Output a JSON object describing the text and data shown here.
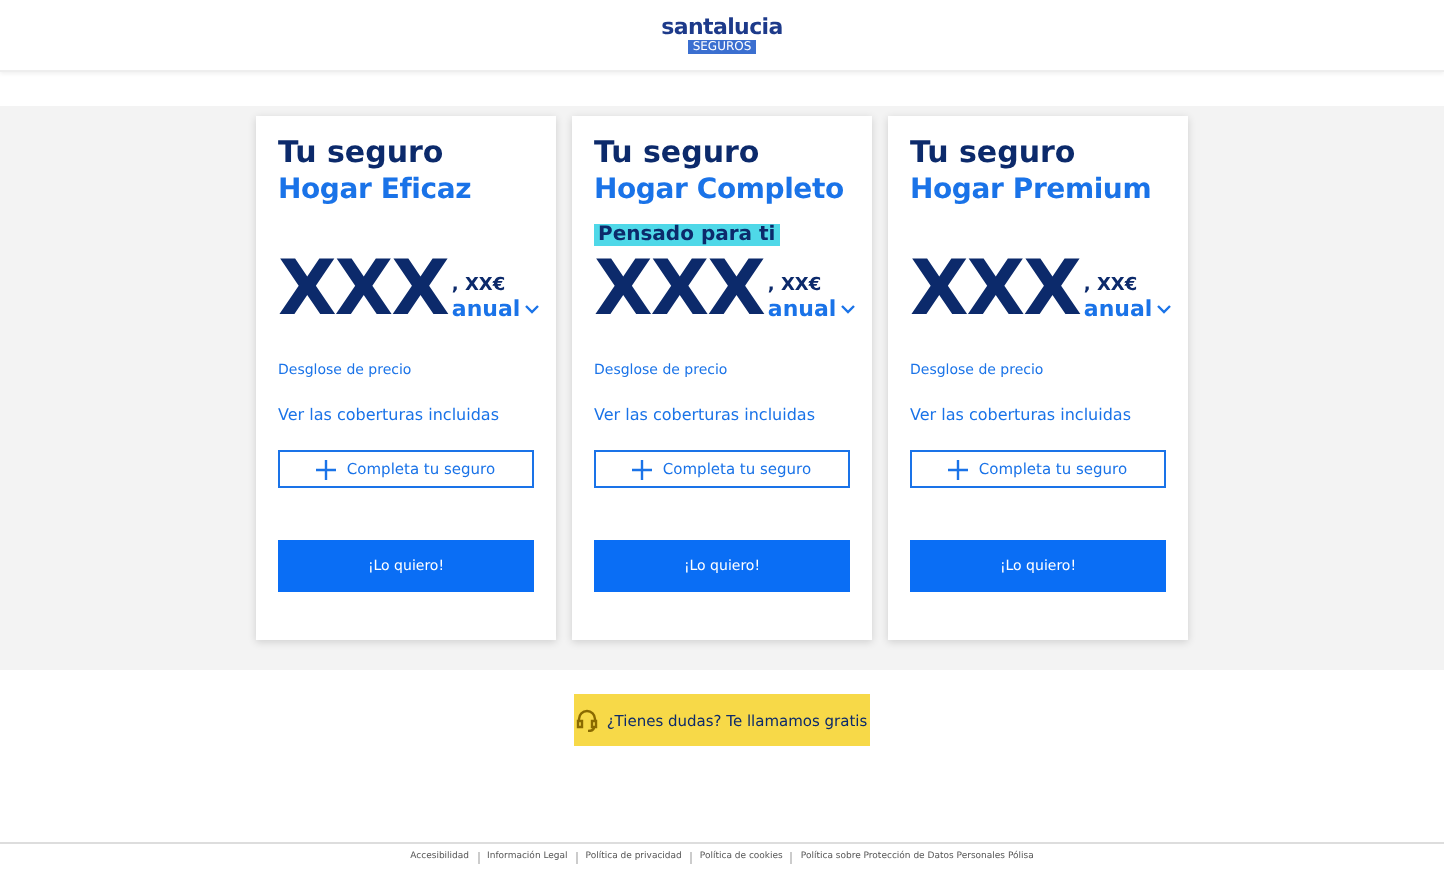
{
  "header": {
    "logo": "santalucia",
    "logo_sub": "SEGUROS"
  },
  "cards": [
    {
      "title": "Tu seguro",
      "product": "Hogar Eficaz",
      "price": "XXX",
      "cents": ", XX€",
      "period": "anual",
      "breakdown": "Desglose de precio",
      "coverages": "Ver las coberturas incluidas",
      "complete": "Completa tu seguro",
      "cta": "¡Lo quiero!"
    },
    {
      "title": "Tu seguro",
      "product": "Hogar Completo",
      "badge": "Pensado para ti",
      "price": "XXX",
      "cents": ", XX€",
      "period": "anual",
      "breakdown": "Desglose de precio",
      "coverages": "Ver las coberturas incluidas",
      "complete": "Completa tu seguro",
      "cta": "¡Lo quiero!"
    },
    {
      "title": "Tu seguro",
      "product": "Hogar Premium",
      "price": "XXX",
      "cents": ", XX€",
      "period": "anual",
      "breakdown": "Desglose de precio",
      "coverages": "Ver las coberturas incluidas",
      "complete": "Completa tu seguro",
      "cta": "¡Lo quiero!"
    }
  ],
  "callback_button": "¿Tienes dudas? Te llamamos gratis",
  "footer_links": [
    "Accesibilidad",
    "Información Legal",
    "Política de privacidad",
    "Política de cookies",
    "Política sobre Protección de Datos Personales Pólisa"
  ]
}
